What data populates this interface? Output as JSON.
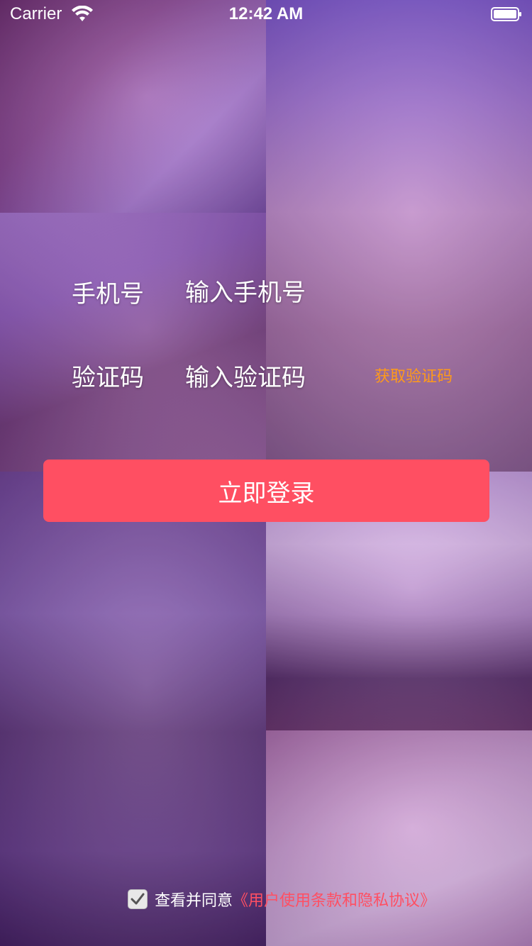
{
  "status_bar": {
    "carrier": "Carrier",
    "time": "12:42 AM"
  },
  "form": {
    "phone_label": "手机号",
    "phone_placeholder": "输入手机号",
    "code_label": "验证码",
    "code_placeholder": "输入验证码",
    "get_code_label": "获取验证码"
  },
  "login_button": {
    "label": "立即登录"
  },
  "agreement": {
    "checked": true,
    "text": "查看并同意",
    "link_text": "《用户使用条款和隐私协议》"
  },
  "colors": {
    "accent": "#ff4f62",
    "get_code": "#ff9a1a",
    "text": "#ffffff"
  }
}
